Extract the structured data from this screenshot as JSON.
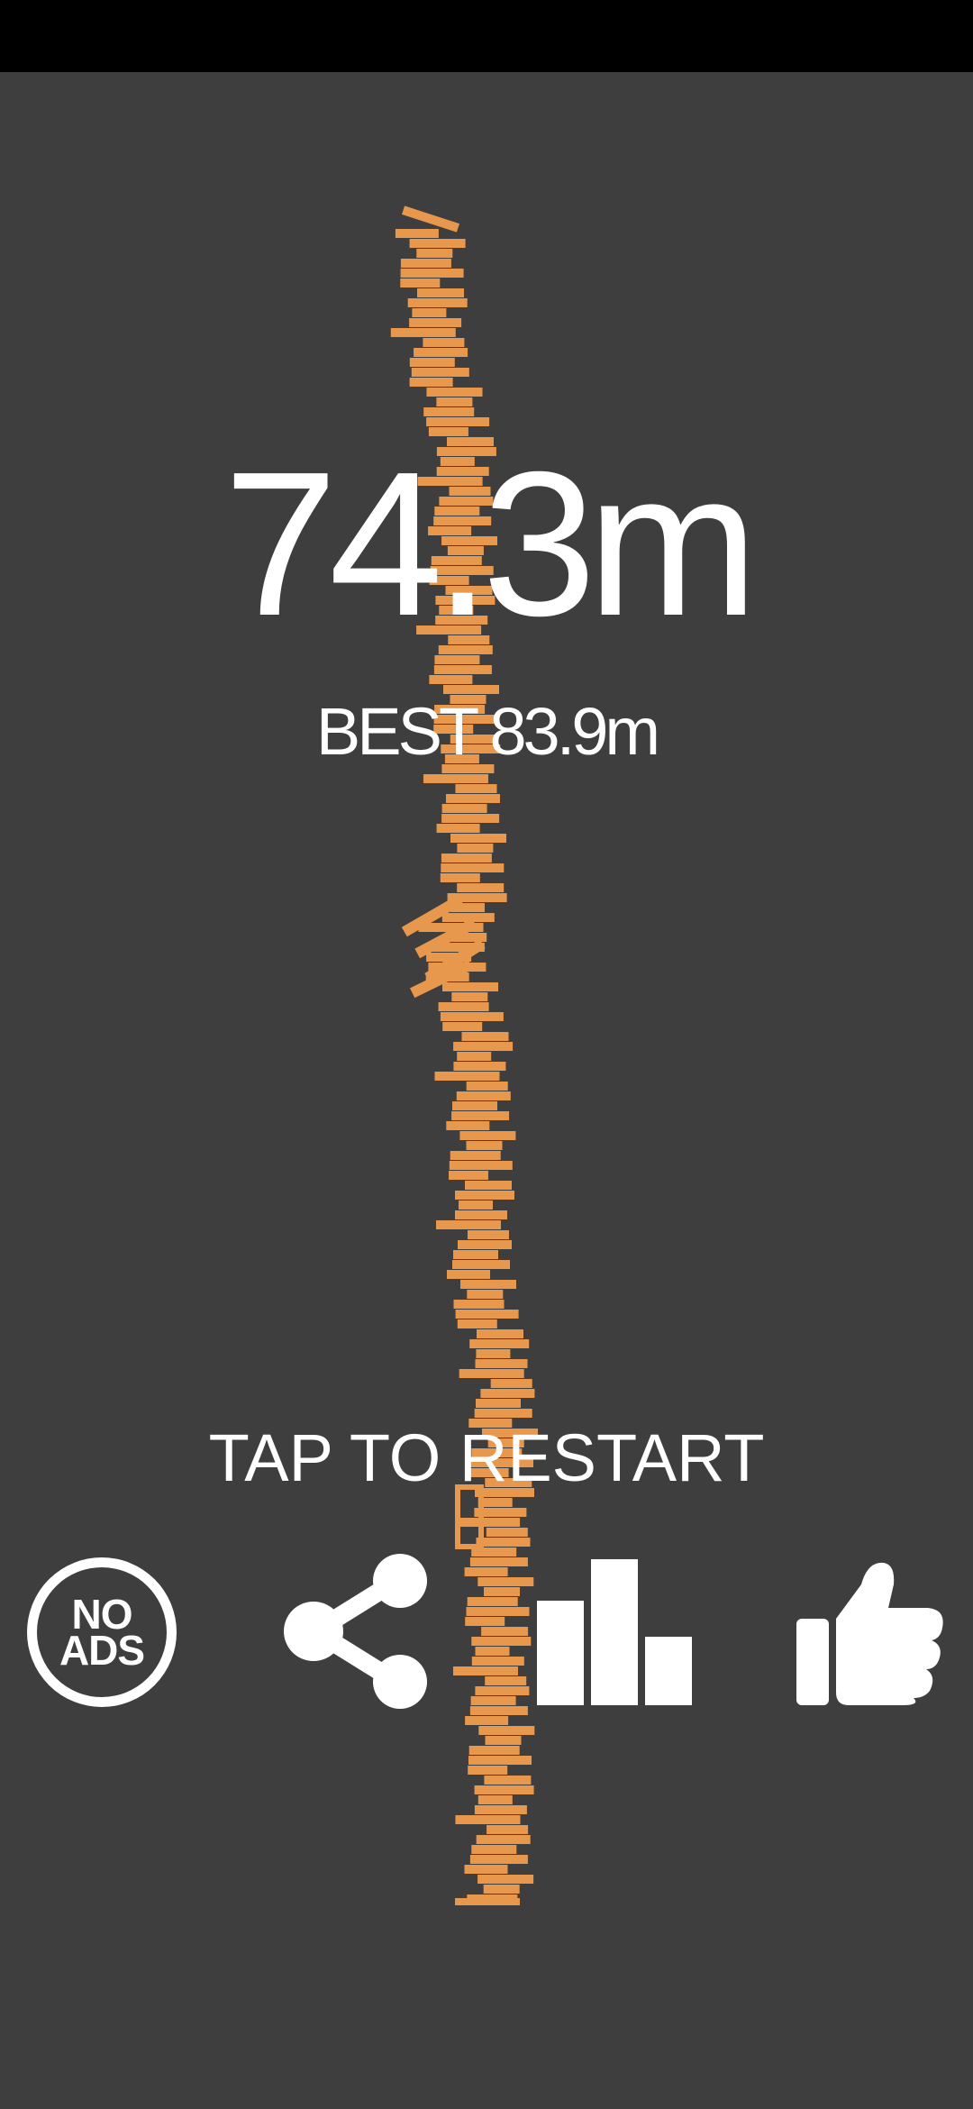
{
  "score": {
    "current": "74.3m",
    "best": "BEST 83.9m"
  },
  "prompt": "TAP TO RESTART",
  "buttons": {
    "no_ads": {
      "line1": "NO",
      "line2": "ADS",
      "icon": "no-ads-icon"
    },
    "share": {
      "icon": "share-icon"
    },
    "leaderboard": {
      "icon": "bar-chart-icon"
    },
    "like": {
      "icon": "thumbs-up-icon"
    }
  },
  "colors": {
    "background": "#3f3e3e",
    "block": "#e8984c",
    "text": "#ffffff"
  }
}
